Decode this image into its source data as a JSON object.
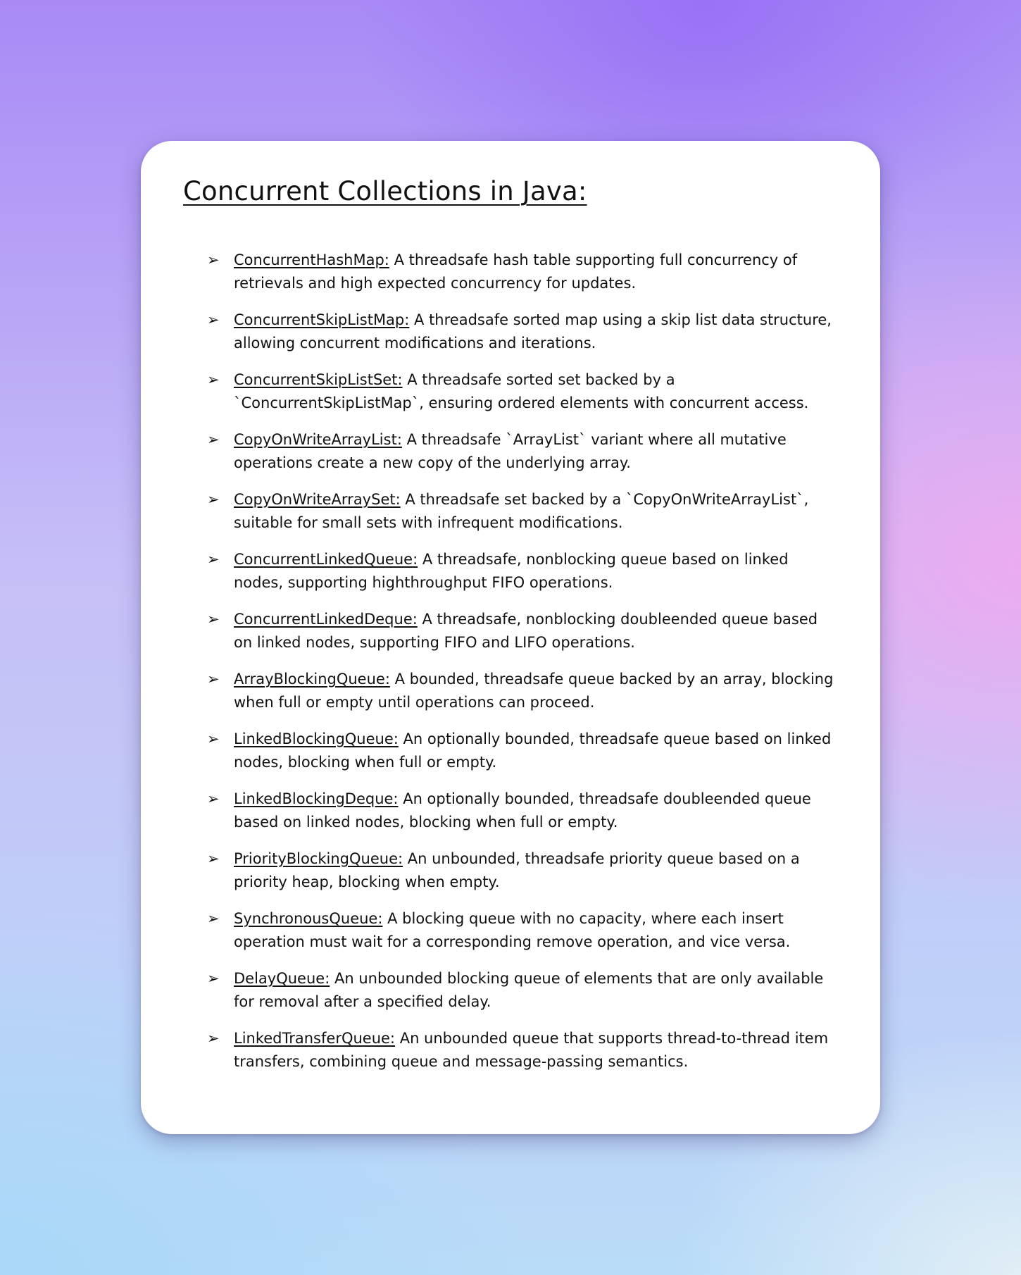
{
  "title": "Concurrent Collections in Java:",
  "bullet_symbol": "➢",
  "items": [
    {
      "term": "ConcurrentHashMap:",
      "desc": "A threadsafe hash table supporting full concurrency of retrievals and high expected concurrency for updates."
    },
    {
      "term": "ConcurrentSkipListMap:",
      "desc": "A threadsafe sorted map using a skip list data structure, allowing concurrent modifications and iterations."
    },
    {
      "term": "ConcurrentSkipListSet:",
      "desc": "A threadsafe sorted set backed by a `ConcurrentSkipListMap`, ensuring ordered elements with concurrent access."
    },
    {
      "term": "CopyOnWriteArrayList:",
      "desc": "A threadsafe `ArrayList` variant where all mutative operations create a new copy of the underlying array."
    },
    {
      "term": "CopyOnWriteArraySet:",
      "desc": "A threadsafe set backed by a `CopyOnWriteArrayList`, suitable for small sets with infrequent modifications."
    },
    {
      "term": "ConcurrentLinkedQueue:",
      "desc": "A threadsafe, nonblocking queue based on linked nodes, supporting highthroughput FIFO operations."
    },
    {
      "term": "ConcurrentLinkedDeque:",
      "desc": "A threadsafe, nonblocking doubleended queue based on linked nodes, supporting FIFO and LIFO operations."
    },
    {
      "term": "ArrayBlockingQueue:",
      "desc": "A bounded, threadsafe queue backed by an array, blocking when full or empty until operations can proceed."
    },
    {
      "term": "LinkedBlockingQueue:",
      "desc": "An optionally bounded, threadsafe queue based on linked nodes, blocking when full or empty."
    },
    {
      "term": "LinkedBlockingDeque:",
      "desc": "An optionally bounded, threadsafe doubleended queue based on linked nodes, blocking when full or empty."
    },
    {
      "term": "PriorityBlockingQueue:",
      "desc": "An unbounded, threadsafe priority queue based on a priority heap, blocking when empty."
    },
    {
      "term": "SynchronousQueue:",
      "desc": "A blocking queue with no capacity, where each insert operation must wait for a corresponding remove operation, and vice versa."
    },
    {
      "term": "DelayQueue:",
      "desc": "An unbounded blocking queue of elements that are only available for removal after a specified delay."
    },
    {
      "term": "LinkedTransferQueue:",
      "desc": "An unbounded queue that supports thread-to-thread item transfers, combining queue and message-passing semantics."
    }
  ]
}
